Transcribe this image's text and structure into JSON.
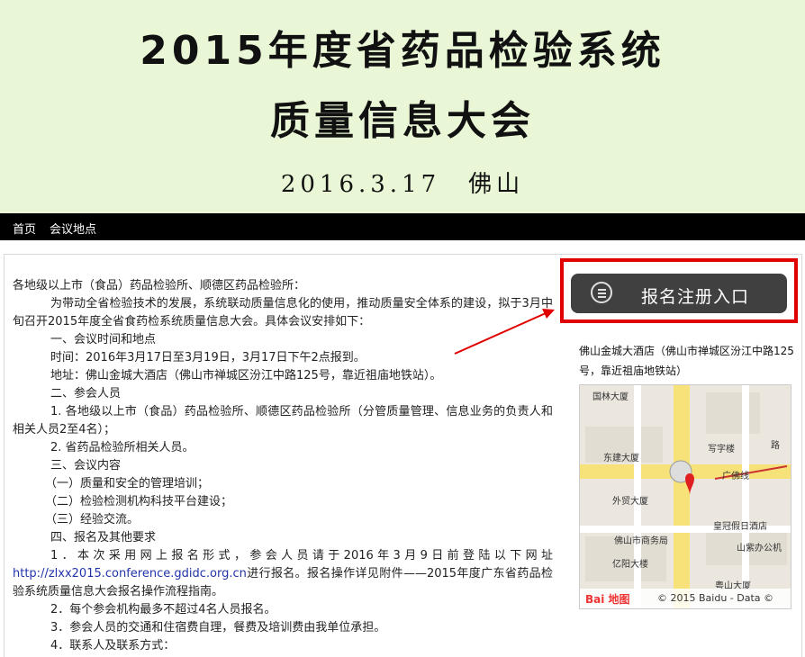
{
  "banner": {
    "title_line1": "2015年度省药品检验系统",
    "title_line2": "质量信息大会",
    "date_place": "2016.3.17　佛山"
  },
  "nav": {
    "items": [
      {
        "label": "首页"
      },
      {
        "label": "会议地点"
      }
    ]
  },
  "article": {
    "salutation": "各地级以上市（食品）药品检验所、顺德区药品检验所：",
    "intro": "为带动全省检验技术的发展，系统联动质量信息化的使用，推动质量安全体系的建设，拟于3月中旬召开2015年度全省食药检系统质量信息大会。具体会议安排如下：",
    "s1_title": "一、会议时间和地点",
    "s1_time": "时间：2016年3月17日至3月19日，3月17日下午2点报到。",
    "s1_addr": "地址：佛山金城大酒店（佛山市禅城区汾江中路125号，靠近祖庙地铁站）。",
    "s2_title": "二、参会人员",
    "s2_item1": "1. 各地级以上市（食品）药品检验所、顺德区药品检验所（分管质量管理、信息业务的负责人和相关人员2至4名）；",
    "s2_item2": "2. 省药品检验所相关人员。",
    "s3_title": "三、会议内容",
    "s3_item1": "（一）质量和安全的管理培训；",
    "s3_item2": "（二）检验检测机构科技平台建设；",
    "s3_item3": "（三）经验交流。",
    "s4_title": "四、报名及其他要求",
    "s4_item1_pre": "1．本次采用网上报名形式，参会人员请于2016年3月9日前登陆以下网址",
    "s4_item1_link": "http://zlxx2015.conference.gdidc.org.cn",
    "s4_item1_post": "进行报名。报名操作详见附件——2015年度广东省药品检验系统质量信息大会报名操作流程指南。",
    "s4_item2": "2．每个参会机构最多不超过4名人员报名。",
    "s4_item3": "3．参会人员的交通和住宿费自理，餐费及培训费由我单位承担。",
    "s4_item4": "4．联系人及联系方式："
  },
  "sidebar": {
    "register_button": "报名注册入口",
    "register_icon": "list-icon",
    "hotel_info": "佛山金城大酒店（佛山市禅城区汾江中路125号，靠近祖庙地铁站）",
    "map": {
      "labels": [
        "国林大厦",
        "东建大厦",
        "写字楼",
        "广佛线",
        "外贸大厦",
        "皇冠假日酒店",
        "佛山市商务局",
        "山紫办公机",
        "亿阳大楼",
        "粤山大厦",
        "路"
      ],
      "logo": "Bai 地图",
      "copyright": "© 2015 Baidu - Data ©"
    }
  },
  "colors": {
    "banner_bg": "#e9f7d6",
    "nav_bg": "#000000",
    "highlight_red": "#e00000",
    "button_bg": "#404040"
  }
}
